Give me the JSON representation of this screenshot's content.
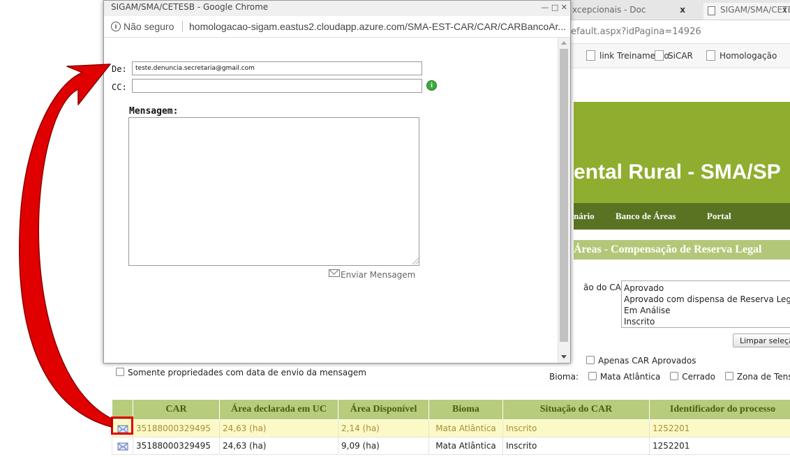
{
  "background_browser": {
    "tab1_title": "xcepcionais - Doc",
    "tab1_close": "x",
    "tab2_title": "SIGAM/SMA/CETESB",
    "tab2_close": "x",
    "address": "efault.aspx?idPagina=14926",
    "bookmarks": [
      "link Treinamento",
      "SiCAR",
      "Homologação"
    ]
  },
  "site": {
    "title": "ental Rural - SMA/SP",
    "nav": [
      "nário",
      "Banco de Áreas",
      "Portal"
    ],
    "section_title": "Áreas - Compensação de Reserva Legal",
    "colors": {
      "banner": "#8fad2f",
      "nav": "#5a7323",
      "section": "#b2c878",
      "table_header": "#b7cc7c"
    }
  },
  "filters": {
    "situacao_label": "ão do CAR",
    "situacao_options": [
      "Aprovado",
      "Aprovado com dispensa de Reserva Legal",
      "Em Análise",
      "Inscrito"
    ],
    "limpar_label": "Limpar seleção",
    "apenas_car_label": "Apenas CAR Aprovados",
    "somente_label": "Somente propriedades com data de envio da mensagem",
    "bioma_label": "Bioma:",
    "bioma_options": [
      "Mata Atlântica",
      "Cerrado",
      "Zona de Tensão"
    ]
  },
  "table": {
    "headers": [
      "",
      "CAR",
      "Área declarada em UC",
      "Área Disponível",
      "Bioma",
      "Situação do CAR",
      "Identificador do processo"
    ],
    "rows": [
      {
        "car": "35188000329495",
        "area_declarada": "24,63 (ha)",
        "area_disponivel": "2,14 (ha)",
        "bioma": "Mata Atlântica",
        "situacao": "Inscrito",
        "identificador": "1252201",
        "icon": "send-mail-icon"
      },
      {
        "car": "35188000329495",
        "area_declarada": "24,63 (ha)",
        "area_disponivel": "9,09 (ha)",
        "bioma": "Mata Atlântica",
        "situacao": "Inscrito",
        "identificador": "1252201",
        "icon": "send-mail-icon"
      }
    ]
  },
  "popup": {
    "window_title": "SIGAM/SMA/CETESB - Google Chrome",
    "window_buttons": "—   □   ✕",
    "info_icon": "i",
    "security_text": "Não seguro",
    "url": "homologacao-sigam.eastus2.cloudapp.azure.com/SMA-EST-CAR/CAR/CARBancoAr...",
    "de_label": "De:",
    "de_value": "teste.denuncia.secretaria@gmail.com",
    "cc_label": "CC:",
    "cc_value": "",
    "help_icon": "i",
    "mensagem_label": "Mensagem:",
    "mensagem_value": "",
    "send_label": "Enviar Mensagem"
  },
  "annotation": {
    "arrow_color": "#e00000"
  }
}
